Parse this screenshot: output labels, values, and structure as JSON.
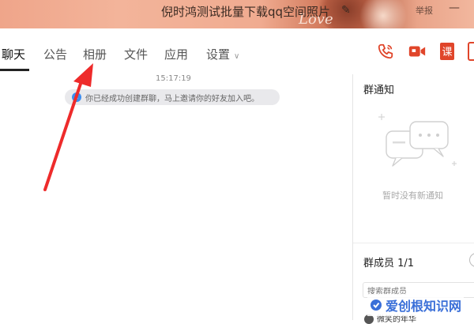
{
  "window": {
    "title": "倪时鸿测试批量下载qq空间照片",
    "decor_text": "Love",
    "report_label": "举报",
    "edit_icon": "pencil-icon",
    "accent_color": "#e0452a"
  },
  "tabs": [
    {
      "label": "聊天",
      "active": true
    },
    {
      "label": "公告",
      "active": false
    },
    {
      "label": "相册",
      "active": false
    },
    {
      "label": "文件",
      "active": false
    },
    {
      "label": "应用",
      "active": false
    },
    {
      "label": "设置",
      "active": false,
      "has_dropdown": true
    }
  ],
  "toolbar": [
    {
      "name": "phone-call-icon"
    },
    {
      "name": "video-call-icon"
    },
    {
      "name": "lesson-icon",
      "glyph": "课"
    },
    {
      "name": "more-icon"
    }
  ],
  "chat": {
    "timestamp": "15:17:19",
    "system_message": "你已经成功创建群聊，马上邀请你的好友加入吧。"
  },
  "side_panel": {
    "notice_title": "群通知",
    "notice_empty": "暂时没有新通知",
    "members_title": "群成员 1/1",
    "member_search_placeholder": "搜索群成员",
    "member_name": "微笑的年华"
  },
  "watermark": {
    "text": "爱创根知识网"
  }
}
